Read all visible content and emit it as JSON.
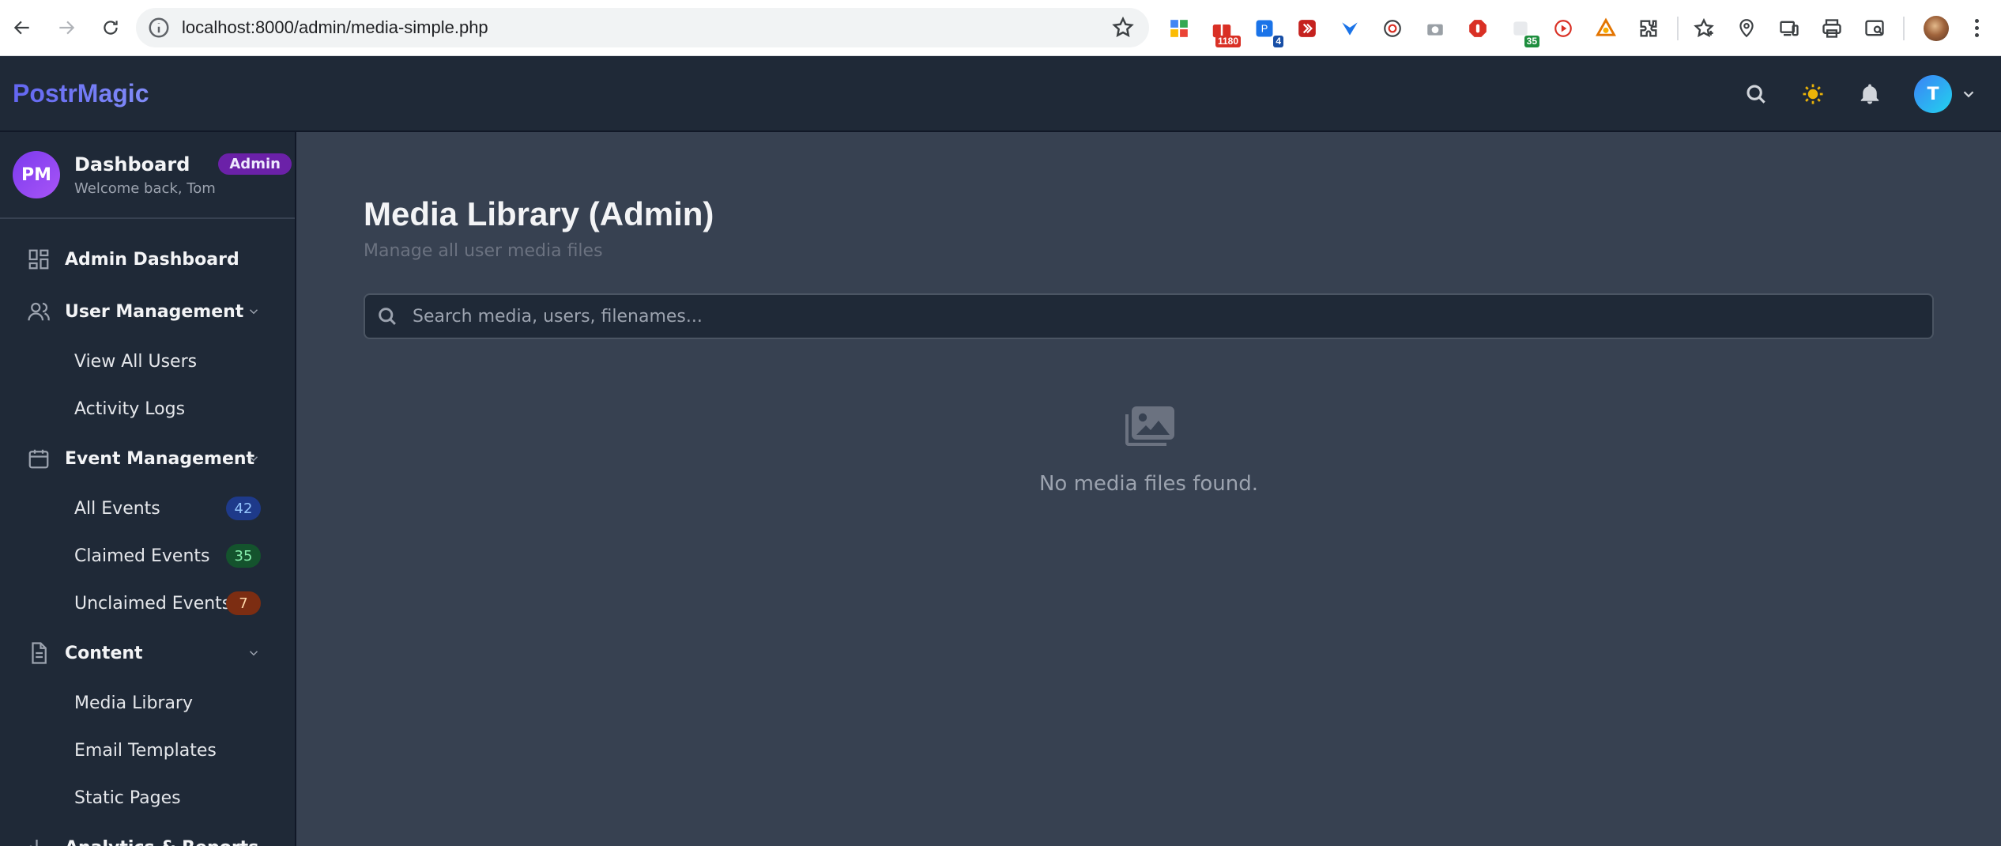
{
  "browser": {
    "url": "localhost:8000/admin/media-simple.php",
    "extensions": [
      {
        "icon": "grid-apps-icon",
        "badge": ""
      },
      {
        "icon": "gift-icon",
        "badge": "1180",
        "badge_color": "#d93025"
      },
      {
        "icon": "tab-count-icon",
        "badge": "4",
        "badge_color": "#1a73e8"
      },
      {
        "icon": "forward-red-icon",
        "badge": ""
      },
      {
        "icon": "bird-logo-icon",
        "badge": ""
      },
      {
        "icon": "target-icon",
        "badge": ""
      },
      {
        "icon": "camera-icon",
        "badge": ""
      },
      {
        "icon": "stop-shield-icon",
        "badge": ""
      },
      {
        "icon": "green-counter-icon",
        "badge": "35",
        "badge_color": "#1e8e3e"
      },
      {
        "icon": "play-circle-icon",
        "badge": ""
      },
      {
        "icon": "triangle-logo-icon",
        "badge": ""
      },
      {
        "icon": "puzzle-icon",
        "badge": ""
      }
    ]
  },
  "app": {
    "brand": "PostrMagic",
    "user_initial": "T"
  },
  "sidebar": {
    "avatar_initials": "PM",
    "title": "Dashboard",
    "role_badge": "Admin",
    "welcome": "Welcome back, Tom",
    "sections": {
      "admin_dashboard": "Admin Dashboard",
      "user_management": "User Management",
      "view_all_users": "View All Users",
      "activity_logs": "Activity Logs",
      "event_management": "Event Management",
      "all_events": "All Events",
      "all_events_count": "42",
      "claimed_events": "Claimed Events",
      "claimed_events_count": "35",
      "unclaimed_events": "Unclaimed Events",
      "unclaimed_events_count": "7",
      "content": "Content",
      "media_library": "Media Library",
      "email_templates": "Email Templates",
      "static_pages": "Static Pages",
      "analytics_reports": "Analytics & Reports"
    }
  },
  "main": {
    "title": "Media Library (Admin)",
    "subtitle": "Manage all user media files",
    "search_placeholder": "Search media, users, filenames...",
    "empty_message": "No media files found."
  },
  "colors": {
    "accent": "#6366f1",
    "sidebar_bg": "#1f2937",
    "main_bg": "#374151",
    "sun": "#eab308"
  }
}
